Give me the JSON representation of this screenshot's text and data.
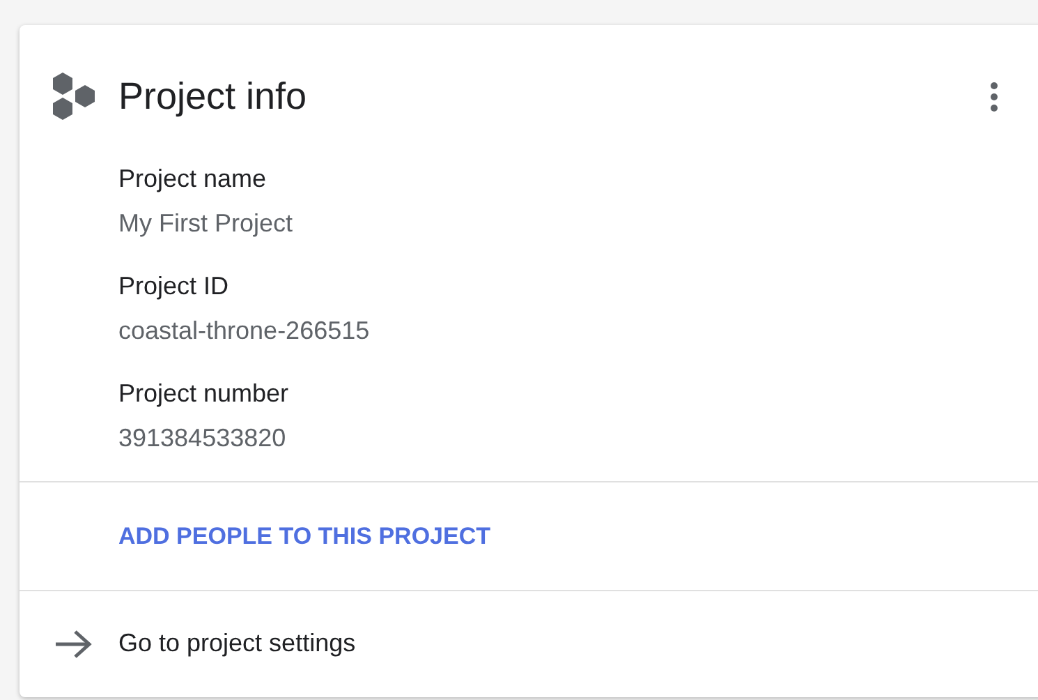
{
  "card": {
    "title": "Project info",
    "fields": [
      {
        "label": "Project name",
        "value": "My First Project"
      },
      {
        "label": "Project ID",
        "value": "coastal-throne-266515"
      },
      {
        "label": "Project number",
        "value": "391384533820"
      }
    ],
    "action": "ADD PEOPLE TO THIS PROJECT",
    "link": "Go to project settings"
  }
}
